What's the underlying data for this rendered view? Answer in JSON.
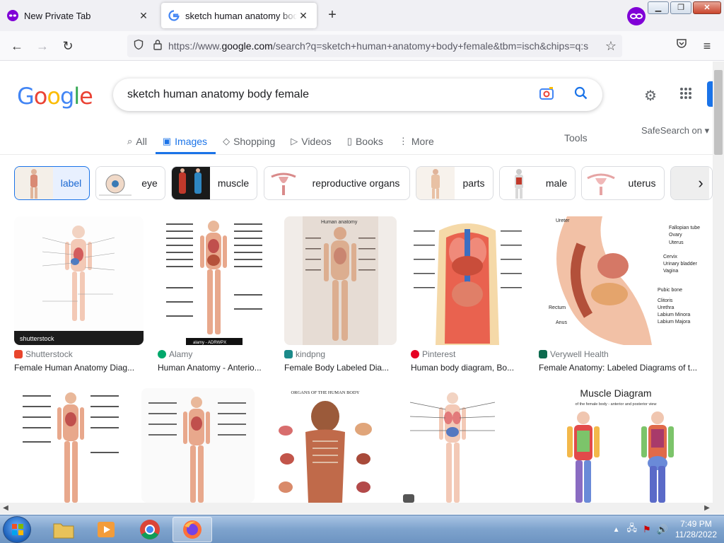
{
  "browser": {
    "tabs": [
      {
        "title": "New Private Tab",
        "active": false
      },
      {
        "title": "sketch human anatomy body female - Google Search",
        "active": true
      }
    ],
    "url_prefix": "https://www.",
    "url_domain": "google.com",
    "url_rest": "/search?q=sketch+human+anatomy+body+female&tbm=isch&chips=q:s"
  },
  "google": {
    "logo": "Google",
    "query": "sketch human anatomy body female",
    "nav_tabs": [
      {
        "label": "All",
        "icon": "search-icon",
        "active": false
      },
      {
        "label": "Images",
        "icon": "image-icon",
        "active": true
      },
      {
        "label": "Shopping",
        "icon": "tag-icon",
        "active": false
      },
      {
        "label": "Videos",
        "icon": "play-icon",
        "active": false
      },
      {
        "label": "Books",
        "icon": "book-icon",
        "active": false
      },
      {
        "label": "More",
        "icon": "dots-vertical-icon",
        "active": false
      }
    ],
    "tools_label": "Tools",
    "safesearch_label": "SafeSearch on"
  },
  "chips": [
    {
      "label": "label",
      "selected": true
    },
    {
      "label": "eye",
      "selected": false
    },
    {
      "label": "muscle",
      "selected": false
    },
    {
      "label": "reproductive organs",
      "selected": false
    },
    {
      "label": "parts",
      "selected": false
    },
    {
      "label": "male",
      "selected": false
    },
    {
      "label": "uterus",
      "selected": false
    }
  ],
  "results_row1": [
    {
      "source": "Shutterstock",
      "caption": "Female Human Anatomy Diag...",
      "fav_color": "#e8452c"
    },
    {
      "source": "Alamy",
      "caption": "Human Anatomy - Anterio...",
      "fav_color": "#00a86b"
    },
    {
      "source": "kindpng",
      "caption": "Female Body Labeled Dia...",
      "fav_color": "#1b8a8a"
    },
    {
      "source": "Pinterest",
      "caption": "Human body diagram, Bo...",
      "fav_color": "#e60023"
    },
    {
      "source": "Verywell Health",
      "caption": "Female Anatomy: Labeled Diagrams of t...",
      "fav_color": "#0d6b4f"
    }
  ],
  "results_row2": [
    {
      "title": ""
    },
    {
      "title": ""
    },
    {
      "title": "ORGANS OF THE HUMAN BODY"
    },
    {
      "title": ""
    },
    {
      "title": "Muscle Diagram",
      "subtitle": "of the female body - anterior and posterior view"
    }
  ],
  "image_texts": {
    "human_anatomy": "Human anatomy",
    "watermark": "shutterstock",
    "alamy": "alamy - ADRWPX",
    "verywell_labels": [
      "Ureter",
      "Fallopian tube",
      "Ovary",
      "Uterus",
      "Cervix",
      "Urinary bladder",
      "Vagina",
      "Pubic bone",
      "Clitoris",
      "Urethra",
      "Labium Minora",
      "Labium Majora",
      "Rectum",
      "Anus"
    ]
  },
  "taskbar": {
    "time": "7:49 PM",
    "date": "11/28/2022"
  },
  "colors": {
    "accent": "#1a73e8",
    "private_purple": "#8000d7"
  }
}
